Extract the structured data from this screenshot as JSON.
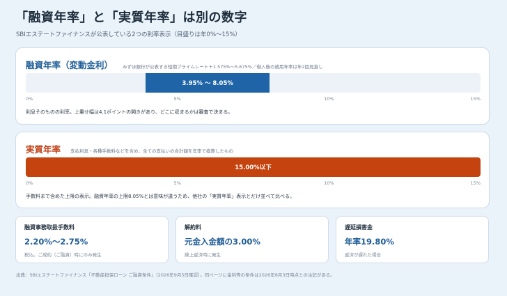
{
  "title": "「融資年率」と「実質年率」は別の数字",
  "subtitle": "SBIエステートファイナンスが公表している2つの利率表示（目盛りは年0%〜15%）",
  "axis": {
    "min": 0,
    "max": 15,
    "ticks": [
      "0%",
      "5%",
      "10%",
      "15%"
    ]
  },
  "chart_data": [
    {
      "type": "bar",
      "title": "融資年率（変動金利）",
      "range": [
        3.95,
        8.05
      ],
      "label": "3.95% 〜 8.05%",
      "xlim": [
        0,
        15
      ]
    },
    {
      "type": "bar",
      "title": "実質年率",
      "range": [
        0,
        15
      ],
      "label": "15.00%以下",
      "xlim": [
        0,
        15
      ]
    }
  ],
  "panel_financing": {
    "title": "融資年率（変動金利）",
    "note": "みずほ銀行が公表する短期プライムレート＋1.575%〜5.675%／借入後の適用年率は年2回見直し",
    "bar_label": "3.95% 〜 8.05%",
    "description": "利息そのものの利率。上乗せ幅は4.1ポイントの開きがあり、どこに収まるかは審査で決まる。"
  },
  "panel_real": {
    "title": "実質年率",
    "note": "支払利息・各種手数料などを含め、全ての支払いの合計額を年率で換算したもの",
    "bar_label": "15.00%以下",
    "description": "手数料まで含めた上限の表示。融資年率の上限8.05%とは意味が違うため、他社の「実質年率」表示とだけ並べて比べる。"
  },
  "cards": [
    {
      "label": "融資事務取扱手数料",
      "value": "2.20%〜2.75%",
      "note": "税込。ご成約（ご融資）時にのみ発生"
    },
    {
      "label": "解約料",
      "value": "元金入金額の3.00%",
      "note": "繰上返済時に発生"
    },
    {
      "label": "遅延損害金",
      "value": "年率19.80%",
      "note": "返済が遅れた場合"
    }
  ],
  "source": "出典：SBIエステートファイナンス「不動産担保ローン ご融資条件」（2026年9月5日確認）。同ページに金利等の条件は2026年8月3日時点との注記がある。",
  "colors": {
    "financing_bar": "#1e64a6",
    "real_bar": "#c4430f",
    "financing_title": "#21609a",
    "real_title": "#c0441a"
  }
}
